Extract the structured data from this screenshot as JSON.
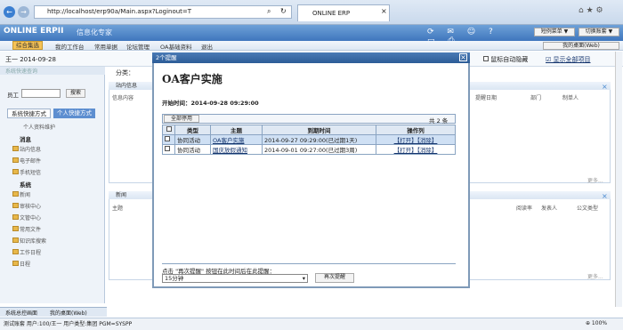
{
  "browser": {
    "url": "http://localhost/erp90a/Main.aspx?Loginout=T",
    "tab_title": "ONLINE ERP",
    "nav_buttons": [
      "←",
      "→"
    ],
    "search_icon": "⌕",
    "refresh_icon": "↻",
    "tab_close": "×",
    "win_ctrl": "⌂ ★ ⚙"
  },
  "app": {
    "brand": "ONLINE ERPII",
    "brand_sub": "信息化专家",
    "right_buttons": [
      "短例菜单 ▼",
      "切换账套 ▼"
    ],
    "desk_label": "我的桌面(Web)"
  },
  "menu": {
    "items": [
      "综合集选",
      "我的工作台",
      "常用单据",
      "论坛管理",
      "OA基础资料",
      "退出"
    ],
    "user_line": "王一  2014-09-28"
  },
  "bar": {
    "auto_hide": "鼠标自动隐藏",
    "show_all": "显示全部项目",
    "fenlei": "分类："
  },
  "sidebar": {
    "search_header": "系统快速查询",
    "emp_label": "员工",
    "search_btn": "搜索",
    "tab_system": "系统快捷方式",
    "tab_personal": "个人快捷方式",
    "personal_info": "个人资料维护",
    "sec_msg": "消息",
    "msg_items": [
      "站内信息",
      "电子邮件",
      "手机短信"
    ],
    "sec_sys": "系统",
    "sys_items": [
      "新闻",
      "审核中心",
      "文管中心",
      "常用文件",
      "知识库搜索",
      "工作日程",
      "日程"
    ],
    "bottom_tabs": [
      "系统总控画面",
      "我的桌面(Web)"
    ]
  },
  "panels": {
    "station": {
      "title": "站内信息",
      "col1": "信息内容",
      "col_date": "提醒日期",
      "col_dept": "部门",
      "col_maker": "制单人",
      "more": "更多..."
    },
    "news": {
      "title": "新闻",
      "col1": "主题",
      "col_read": "阅读率",
      "col_pub": "发表人",
      "col_pubdate": "公文类型",
      "more": "更多..."
    }
  },
  "modal": {
    "title": "2个提醒",
    "heading": "OA客户实施",
    "start_label": "开始时间：2014-09-28 09:29:00",
    "all_btn": "全部停用",
    "count": "共 2 条",
    "headers": [
      "类型",
      "主题",
      "到期时间",
      "操作列"
    ],
    "rows": [
      {
        "type": "协同活动",
        "subject": "OA客户实施",
        "due": "2014-09-27 09:29:00(已过期1天)",
        "ops": "【打开】【消除】"
      },
      {
        "type": "协同活动",
        "subject": "国庆放假通知",
        "due": "2014-09-01 09:27:00(已过期3周)",
        "ops": "【打开】【消除】"
      }
    ],
    "hint": "点击 \"再次提醒\" 按钮在此时间后在此提醒：",
    "select_val": "15分钟",
    "remind_btn": "再次提醒",
    "close": "×"
  },
  "status": {
    "text": "测试账套  用户:100/王一  用户类型:集团  PGM=SYSPP",
    "zoom": "⊕ 100%"
  }
}
